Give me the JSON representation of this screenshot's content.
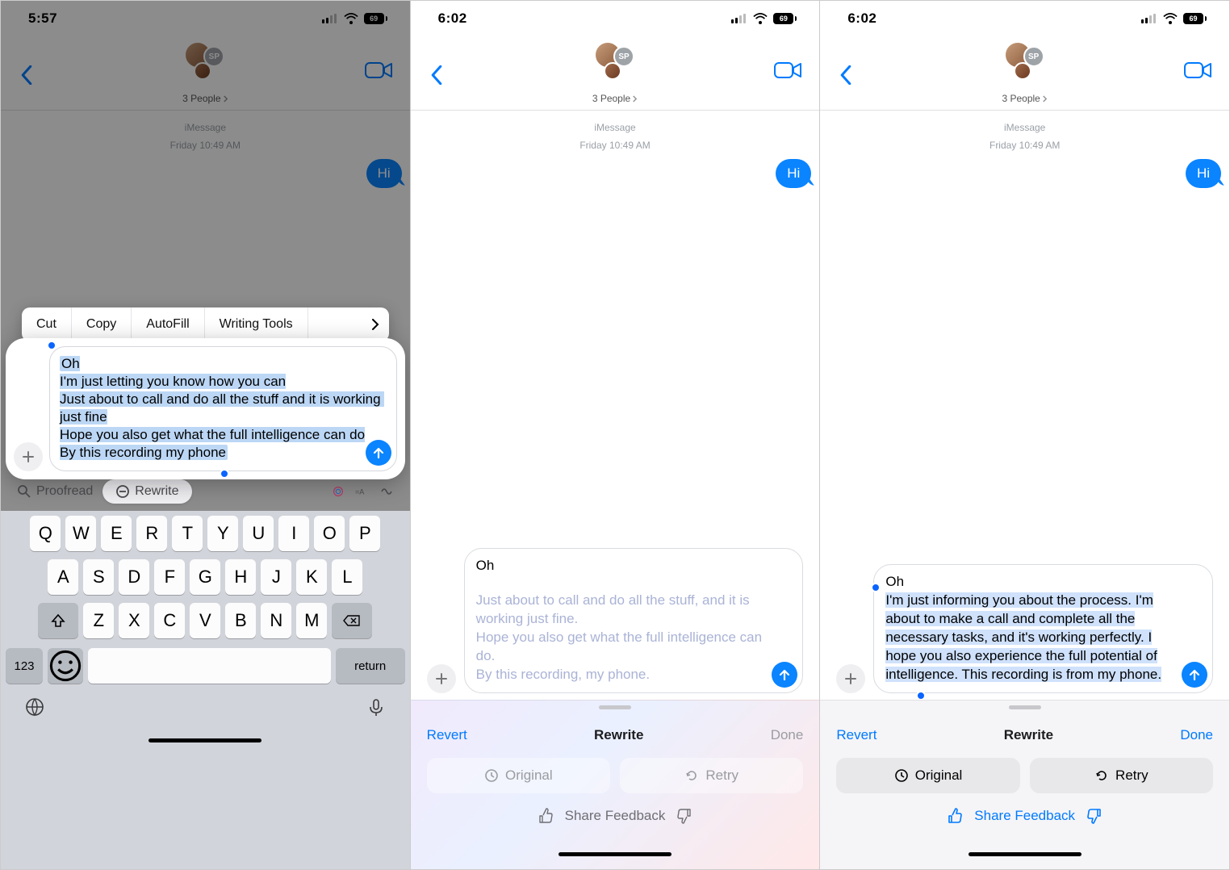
{
  "screens": [
    {
      "status": {
        "time": "5:57",
        "battery": "69"
      },
      "header": {
        "group_label": "3 People",
        "avatar_small_text": "SP"
      },
      "meta": {
        "service": "iMessage",
        "timestamp": "Friday 10:49 AM"
      },
      "bubble_out": "Hi",
      "context_menu": {
        "cut": "Cut",
        "copy": "Copy",
        "autofill": "AutoFill",
        "writing": "Writing Tools"
      },
      "compose_text": "Oh\nI'm just letting you know how you can\nJust about to call and do all the stuff and it is working just fine\nHope you also get what the full intelligence can do\nBy this recording my phone",
      "suggestions": {
        "proofread": "Proofread",
        "rewrite": "Rewrite"
      },
      "keyboard": {
        "row1": [
          "Q",
          "W",
          "E",
          "R",
          "T",
          "Y",
          "U",
          "I",
          "O",
          "P"
        ],
        "row2": [
          "A",
          "S",
          "D",
          "F",
          "G",
          "H",
          "J",
          "K",
          "L"
        ],
        "row3": [
          "Z",
          "X",
          "C",
          "V",
          "B",
          "N",
          "M"
        ],
        "num": "123",
        "return": "return"
      }
    },
    {
      "status": {
        "time": "6:02",
        "battery": "69"
      },
      "header": {
        "group_label": "3 People",
        "avatar_small_text": "SP"
      },
      "meta": {
        "service": "iMessage",
        "timestamp": "Friday 10:49 AM"
      },
      "bubble_out": "Hi",
      "compose_top": "Oh",
      "compose_fade": "Just about to call and do all the stuff, and it is working just fine.\nHope you also get what the full intelligence can do.\nBy this recording, my phone.",
      "rewrite": {
        "revert": "Revert",
        "title": "Rewrite",
        "done": "Done",
        "original": "Original",
        "retry": "Retry",
        "feedback": "Share Feedback"
      }
    },
    {
      "status": {
        "time": "6:02",
        "battery": "69"
      },
      "header": {
        "group_label": "3 People",
        "avatar_small_text": "SP"
      },
      "meta": {
        "service": "iMessage",
        "timestamp": "Friday 10:49 AM"
      },
      "bubble_out": "Hi",
      "compose_head": "Oh",
      "compose_sel": "I'm just informing you about the process. I'm about to make a call and complete all the necessary tasks, and it's working perfectly. I hope you also experience the full potential of intelligence. This recording is from my phone.",
      "rewrite": {
        "revert": "Revert",
        "title": "Rewrite",
        "done": "Done",
        "original": "Original",
        "retry": "Retry",
        "feedback": "Share Feedback"
      }
    }
  ]
}
